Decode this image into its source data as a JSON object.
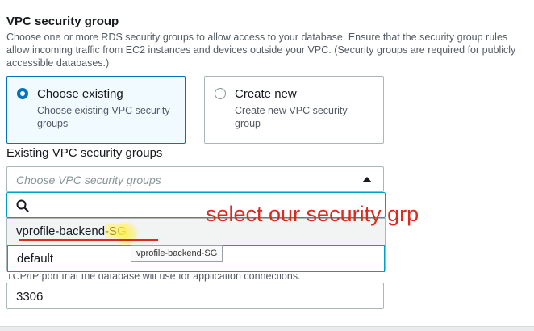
{
  "section": {
    "title": "VPC security group",
    "description": "Choose one or more RDS security groups to allow access to your database. Ensure that the security group rules allow incoming traffic from EC2 instances and devices outside your VPC. (Security groups are required for publicly accessible databases.)"
  },
  "options": {
    "existing": {
      "label": "Choose existing",
      "description": "Choose existing VPC security groups",
      "selected": true
    },
    "create": {
      "label": "Create new",
      "description": "Create new VPC security group",
      "selected": false
    }
  },
  "existing_groups": {
    "label": "Existing VPC security groups",
    "placeholder": "Choose VPC security groups",
    "search_value": "",
    "dropdown": {
      "item1_main": "vprofile-backend",
      "item1_highlight": "-SG",
      "item2": "default"
    },
    "tooltip": "vprofile-backend-SG"
  },
  "annotation": "select our security grp",
  "port": {
    "hint": "TCP/IP port that the database will use for application connections.",
    "value": "3306"
  },
  "colors": {
    "accent": "#0073bb",
    "annotation": "#e0281f",
    "focus": "#00a1c9"
  }
}
